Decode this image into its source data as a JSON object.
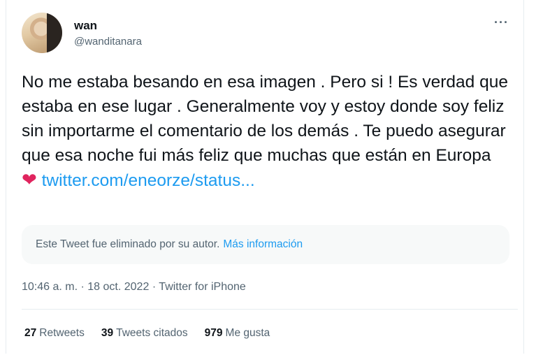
{
  "author": {
    "display_name": "wan",
    "handle": "@wanditanara"
  },
  "more_icon": "···",
  "tweet": {
    "text": "No me estaba besando en esa imagen . Pero si ! Es verdad que estaba en ese lugar . Generalmente voy y estoy donde soy feliz sin importarme el comentario de los demás . Te puedo asegurar que esa noche fui más feliz que muchas que están en Europa",
    "heart": "❤",
    "link": "twitter.com/eneorze/status..."
  },
  "quoted": {
    "message": "Este Tweet fue eliminado por su autor.",
    "more_info": "Más información"
  },
  "meta": {
    "time": "10:46 a. m.",
    "sep1": "·",
    "date": "18 oct. 2022",
    "sep2": "·",
    "source": "Twitter for iPhone"
  },
  "stats": {
    "retweets_count": "27",
    "retweets_label": "Retweets",
    "quotes_count": "39",
    "quotes_label": "Tweets citados",
    "likes_count": "979",
    "likes_label": "Me gusta"
  },
  "colors": {
    "accent": "#1d9bf0",
    "heart": "#e0245e",
    "secondary_text": "#536471"
  }
}
